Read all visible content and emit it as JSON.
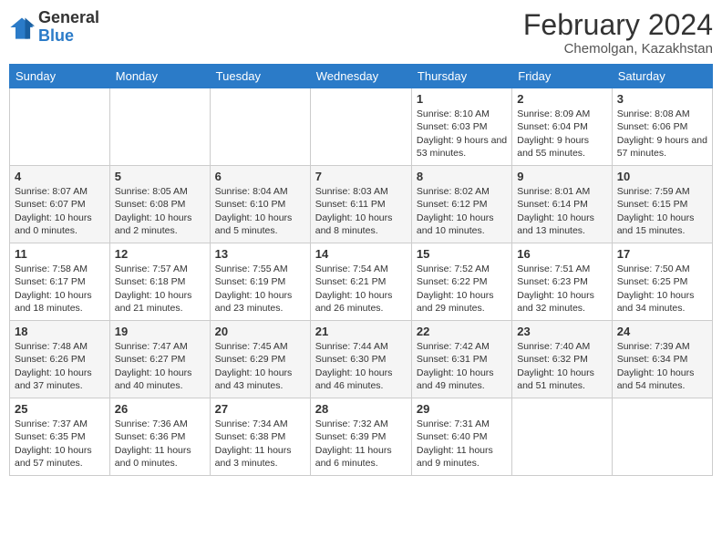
{
  "header": {
    "logo_general": "General",
    "logo_blue": "Blue",
    "main_title": "February 2024",
    "subtitle": "Chemolgan, Kazakhstan"
  },
  "days_of_week": [
    "Sunday",
    "Monday",
    "Tuesday",
    "Wednesday",
    "Thursday",
    "Friday",
    "Saturday"
  ],
  "weeks": [
    [
      {
        "day": "",
        "info": ""
      },
      {
        "day": "",
        "info": ""
      },
      {
        "day": "",
        "info": ""
      },
      {
        "day": "",
        "info": ""
      },
      {
        "day": "1",
        "info": "Sunrise: 8:10 AM\nSunset: 6:03 PM\nDaylight: 9 hours and 53 minutes."
      },
      {
        "day": "2",
        "info": "Sunrise: 8:09 AM\nSunset: 6:04 PM\nDaylight: 9 hours and 55 minutes."
      },
      {
        "day": "3",
        "info": "Sunrise: 8:08 AM\nSunset: 6:06 PM\nDaylight: 9 hours and 57 minutes."
      }
    ],
    [
      {
        "day": "4",
        "info": "Sunrise: 8:07 AM\nSunset: 6:07 PM\nDaylight: 10 hours and 0 minutes."
      },
      {
        "day": "5",
        "info": "Sunrise: 8:05 AM\nSunset: 6:08 PM\nDaylight: 10 hours and 2 minutes."
      },
      {
        "day": "6",
        "info": "Sunrise: 8:04 AM\nSunset: 6:10 PM\nDaylight: 10 hours and 5 minutes."
      },
      {
        "day": "7",
        "info": "Sunrise: 8:03 AM\nSunset: 6:11 PM\nDaylight: 10 hours and 8 minutes."
      },
      {
        "day": "8",
        "info": "Sunrise: 8:02 AM\nSunset: 6:12 PM\nDaylight: 10 hours and 10 minutes."
      },
      {
        "day": "9",
        "info": "Sunrise: 8:01 AM\nSunset: 6:14 PM\nDaylight: 10 hours and 13 minutes."
      },
      {
        "day": "10",
        "info": "Sunrise: 7:59 AM\nSunset: 6:15 PM\nDaylight: 10 hours and 15 minutes."
      }
    ],
    [
      {
        "day": "11",
        "info": "Sunrise: 7:58 AM\nSunset: 6:17 PM\nDaylight: 10 hours and 18 minutes."
      },
      {
        "day": "12",
        "info": "Sunrise: 7:57 AM\nSunset: 6:18 PM\nDaylight: 10 hours and 21 minutes."
      },
      {
        "day": "13",
        "info": "Sunrise: 7:55 AM\nSunset: 6:19 PM\nDaylight: 10 hours and 23 minutes."
      },
      {
        "day": "14",
        "info": "Sunrise: 7:54 AM\nSunset: 6:21 PM\nDaylight: 10 hours and 26 minutes."
      },
      {
        "day": "15",
        "info": "Sunrise: 7:52 AM\nSunset: 6:22 PM\nDaylight: 10 hours and 29 minutes."
      },
      {
        "day": "16",
        "info": "Sunrise: 7:51 AM\nSunset: 6:23 PM\nDaylight: 10 hours and 32 minutes."
      },
      {
        "day": "17",
        "info": "Sunrise: 7:50 AM\nSunset: 6:25 PM\nDaylight: 10 hours and 34 minutes."
      }
    ],
    [
      {
        "day": "18",
        "info": "Sunrise: 7:48 AM\nSunset: 6:26 PM\nDaylight: 10 hours and 37 minutes."
      },
      {
        "day": "19",
        "info": "Sunrise: 7:47 AM\nSunset: 6:27 PM\nDaylight: 10 hours and 40 minutes."
      },
      {
        "day": "20",
        "info": "Sunrise: 7:45 AM\nSunset: 6:29 PM\nDaylight: 10 hours and 43 minutes."
      },
      {
        "day": "21",
        "info": "Sunrise: 7:44 AM\nSunset: 6:30 PM\nDaylight: 10 hours and 46 minutes."
      },
      {
        "day": "22",
        "info": "Sunrise: 7:42 AM\nSunset: 6:31 PM\nDaylight: 10 hours and 49 minutes."
      },
      {
        "day": "23",
        "info": "Sunrise: 7:40 AM\nSunset: 6:32 PM\nDaylight: 10 hours and 51 minutes."
      },
      {
        "day": "24",
        "info": "Sunrise: 7:39 AM\nSunset: 6:34 PM\nDaylight: 10 hours and 54 minutes."
      }
    ],
    [
      {
        "day": "25",
        "info": "Sunrise: 7:37 AM\nSunset: 6:35 PM\nDaylight: 10 hours and 57 minutes."
      },
      {
        "day": "26",
        "info": "Sunrise: 7:36 AM\nSunset: 6:36 PM\nDaylight: 11 hours and 0 minutes."
      },
      {
        "day": "27",
        "info": "Sunrise: 7:34 AM\nSunset: 6:38 PM\nDaylight: 11 hours and 3 minutes."
      },
      {
        "day": "28",
        "info": "Sunrise: 7:32 AM\nSunset: 6:39 PM\nDaylight: 11 hours and 6 minutes."
      },
      {
        "day": "29",
        "info": "Sunrise: 7:31 AM\nSunset: 6:40 PM\nDaylight: 11 hours and 9 minutes."
      },
      {
        "day": "",
        "info": ""
      },
      {
        "day": "",
        "info": ""
      }
    ]
  ]
}
